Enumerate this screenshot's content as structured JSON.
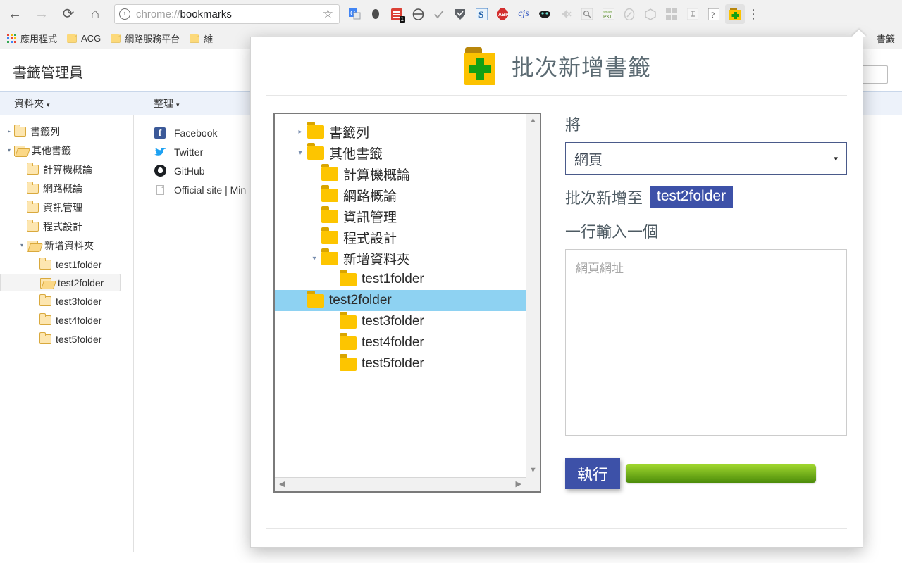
{
  "browser": {
    "nav": {
      "back_icon": "arrow-left-icon",
      "forward_icon": "arrow-right-icon",
      "reload_icon": "reload-icon",
      "home_icon": "home-icon"
    },
    "omnibox": {
      "info_glyph": "i",
      "scheme": "chrome://",
      "rest": "bookmarks",
      "full_url": "chrome://bookmarks",
      "star_glyph": "☆"
    },
    "extensions": [
      {
        "name": "google-translate-icon",
        "glyph": "G",
        "badge": ""
      },
      {
        "name": "evernote-icon",
        "glyph": "●",
        "badge": ""
      },
      {
        "name": "todoist-icon",
        "glyph": "≡",
        "badge": "1"
      },
      {
        "name": "grammar-icon",
        "glyph": "⊘",
        "badge": ""
      },
      {
        "name": "checkmark-icon",
        "glyph": "✓",
        "badge": ""
      },
      {
        "name": "shield-icon",
        "glyph": "▽",
        "badge": ""
      },
      {
        "name": "s-extension-icon",
        "glyph": "S",
        "badge": ""
      },
      {
        "name": "adblock-plus-icon",
        "glyph": "ABP",
        "badge": ""
      },
      {
        "name": "cjs-icon",
        "glyph": "cjs",
        "badge": ""
      },
      {
        "name": "mask-icon",
        "glyph": "◑",
        "badge": ""
      },
      {
        "name": "mute-icon",
        "glyph": "◂",
        "badge": ""
      },
      {
        "name": "search-icon",
        "glyph": "⚲",
        "badge": ""
      },
      {
        "name": "pki-icon",
        "glyph": "PKI",
        "badge": ""
      },
      {
        "name": "slash-circle-icon",
        "glyph": "⊘",
        "badge": ""
      },
      {
        "name": "cube-icon",
        "glyph": "⬡",
        "badge": ""
      },
      {
        "name": "grid-icon",
        "glyph": "▒",
        "badge": ""
      },
      {
        "name": "stamp-icon",
        "glyph": "⚑",
        "badge": ""
      },
      {
        "name": "question-icon",
        "glyph": "?",
        "badge": ""
      }
    ],
    "active_extension": {
      "name": "bulk-add-bookmark-extension-icon"
    },
    "menu_glyph": "⋮"
  },
  "bookmark_bar": {
    "apps_label": "應用程式",
    "items": [
      {
        "label": "ACG"
      },
      {
        "label": "網路服務平台"
      },
      {
        "label": "維"
      }
    ],
    "right_item": "書籤"
  },
  "bookmark_manager": {
    "title": "書籤管理員",
    "col_folders": "資料夾",
    "col_organize": "整理",
    "caret": "▾",
    "tree": [
      {
        "label": "書籤列",
        "indent": 0,
        "twist": "▸",
        "open": false,
        "selected": false
      },
      {
        "label": "其他書籤",
        "indent": 0,
        "twist": "▾",
        "open": true,
        "selected": false
      },
      {
        "label": "計算機概論",
        "indent": 1,
        "twist": "",
        "open": false,
        "selected": false
      },
      {
        "label": "網路概論",
        "indent": 1,
        "twist": "",
        "open": false,
        "selected": false
      },
      {
        "label": "資訊管理",
        "indent": 1,
        "twist": "",
        "open": false,
        "selected": false
      },
      {
        "label": "程式設計",
        "indent": 1,
        "twist": "",
        "open": false,
        "selected": false
      },
      {
        "label": "新增資料夾",
        "indent": 1,
        "twist": "▾",
        "open": true,
        "selected": false
      },
      {
        "label": "test1folder",
        "indent": 2,
        "twist": "",
        "open": false,
        "selected": false
      },
      {
        "label": "test2folder",
        "indent": 2,
        "twist": "",
        "open": true,
        "selected": true
      },
      {
        "label": "test3folder",
        "indent": 2,
        "twist": "",
        "open": false,
        "selected": false
      },
      {
        "label": "test4folder",
        "indent": 2,
        "twist": "",
        "open": false,
        "selected": false
      },
      {
        "label": "test5folder",
        "indent": 2,
        "twist": "",
        "open": false,
        "selected": false
      }
    ],
    "bookmarks": [
      {
        "label": "Facebook",
        "icon": "facebook-icon"
      },
      {
        "label": "Twitter",
        "icon": "twitter-icon"
      },
      {
        "label": "GitHub",
        "icon": "github-icon"
      },
      {
        "label": "Official site | Min",
        "icon": "generic-page-icon"
      }
    ],
    "search_placeholder": ""
  },
  "dialog": {
    "title": "批次新增書籤",
    "logo_name": "bulk-add-bookmark-logo",
    "tree": [
      {
        "label": "書籤列",
        "indent": 0,
        "twist": "▸",
        "selected": false
      },
      {
        "label": "其他書籤",
        "indent": 0,
        "twist": "▾",
        "selected": false
      },
      {
        "label": "計算機概論",
        "indent": 1,
        "twist": "",
        "selected": false
      },
      {
        "label": "網路概論",
        "indent": 1,
        "twist": "",
        "selected": false
      },
      {
        "label": "資訊管理",
        "indent": 1,
        "twist": "",
        "selected": false
      },
      {
        "label": "程式設計",
        "indent": 1,
        "twist": "",
        "selected": false
      },
      {
        "label": "新增資料夾",
        "indent": 1,
        "twist": "▾",
        "selected": false
      },
      {
        "label": "test1folder",
        "indent": 2,
        "twist": "",
        "selected": false
      },
      {
        "label": "test2folder",
        "indent": 2,
        "twist": "",
        "selected": true
      },
      {
        "label": "test3folder",
        "indent": 2,
        "twist": "",
        "selected": false
      },
      {
        "label": "test4folder",
        "indent": 2,
        "twist": "",
        "selected": false
      },
      {
        "label": "test5folder",
        "indent": 2,
        "twist": "",
        "selected": false
      }
    ],
    "scroll": {
      "up_arrow": "▲",
      "down_arrow": "▼",
      "left_arrow": "◀",
      "right_arrow": "▶"
    },
    "form": {
      "type_label": "將",
      "type_value": "網頁",
      "type_arrow": "▾",
      "destination_label": "批次新增至",
      "destination_value": "test2folder",
      "input_hint": "一行輸入一個",
      "textarea_placeholder": "網頁網址",
      "textarea_value": "",
      "run_button": "執行",
      "progress_percent": 100
    }
  },
  "colors": {
    "accent_blue": "#3d51a8",
    "selection_blue": "#8ed2f2",
    "progress_green_light": "#9fd62e",
    "progress_green_dark": "#4c8c0a",
    "folder_yellow": "#fdc500",
    "logo_green": "#13a013"
  }
}
